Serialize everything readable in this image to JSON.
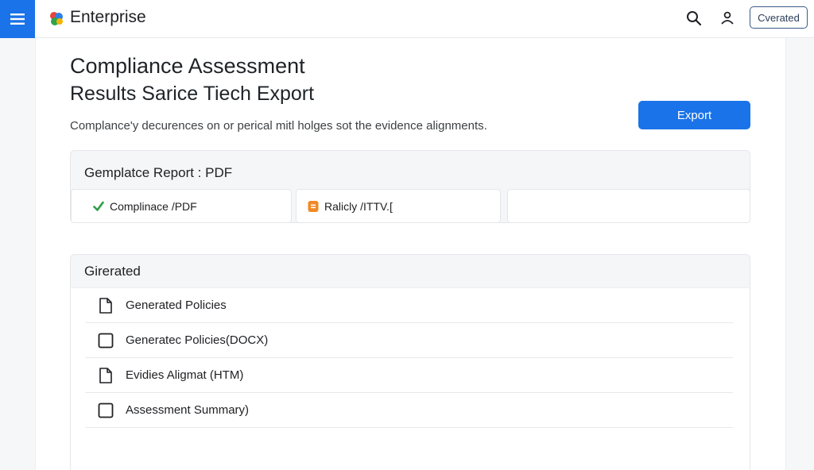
{
  "header": {
    "app_name": "Enterprise",
    "status_chip": "Cverated"
  },
  "page": {
    "title": "Compliance Assessment",
    "subtitle": "Results Sarice Tiech Export",
    "description": "Complance'y decurences on or perical mitl holges sot the evidence alignments.",
    "export_label": "Export"
  },
  "report_card": {
    "title": "Gemplatce Report : PDF",
    "formats": [
      {
        "label": "Complinace /PDF",
        "icon": "check-icon",
        "color": "#2e9e45"
      },
      {
        "label": "Ralicly /ITTV.[",
        "icon": "orange-doc-icon",
        "color": "#f08a24"
      },
      {
        "label": "",
        "icon": ""
      }
    ]
  },
  "generated": {
    "title": "Girerated",
    "items": [
      {
        "label": "Generated Policies",
        "icon": "document-icon"
      },
      {
        "label": "Generatec Policies(DOCX)",
        "icon": "checkbox-icon"
      },
      {
        "label": "Evidies Aligmat (HTM)",
        "icon": "document-icon"
      },
      {
        "label": "Assessment Summary)",
        "icon": "checkbox-icon"
      }
    ]
  },
  "colors": {
    "accent": "#1a73e8",
    "check": "#2e9e45",
    "orange": "#f08a24"
  }
}
